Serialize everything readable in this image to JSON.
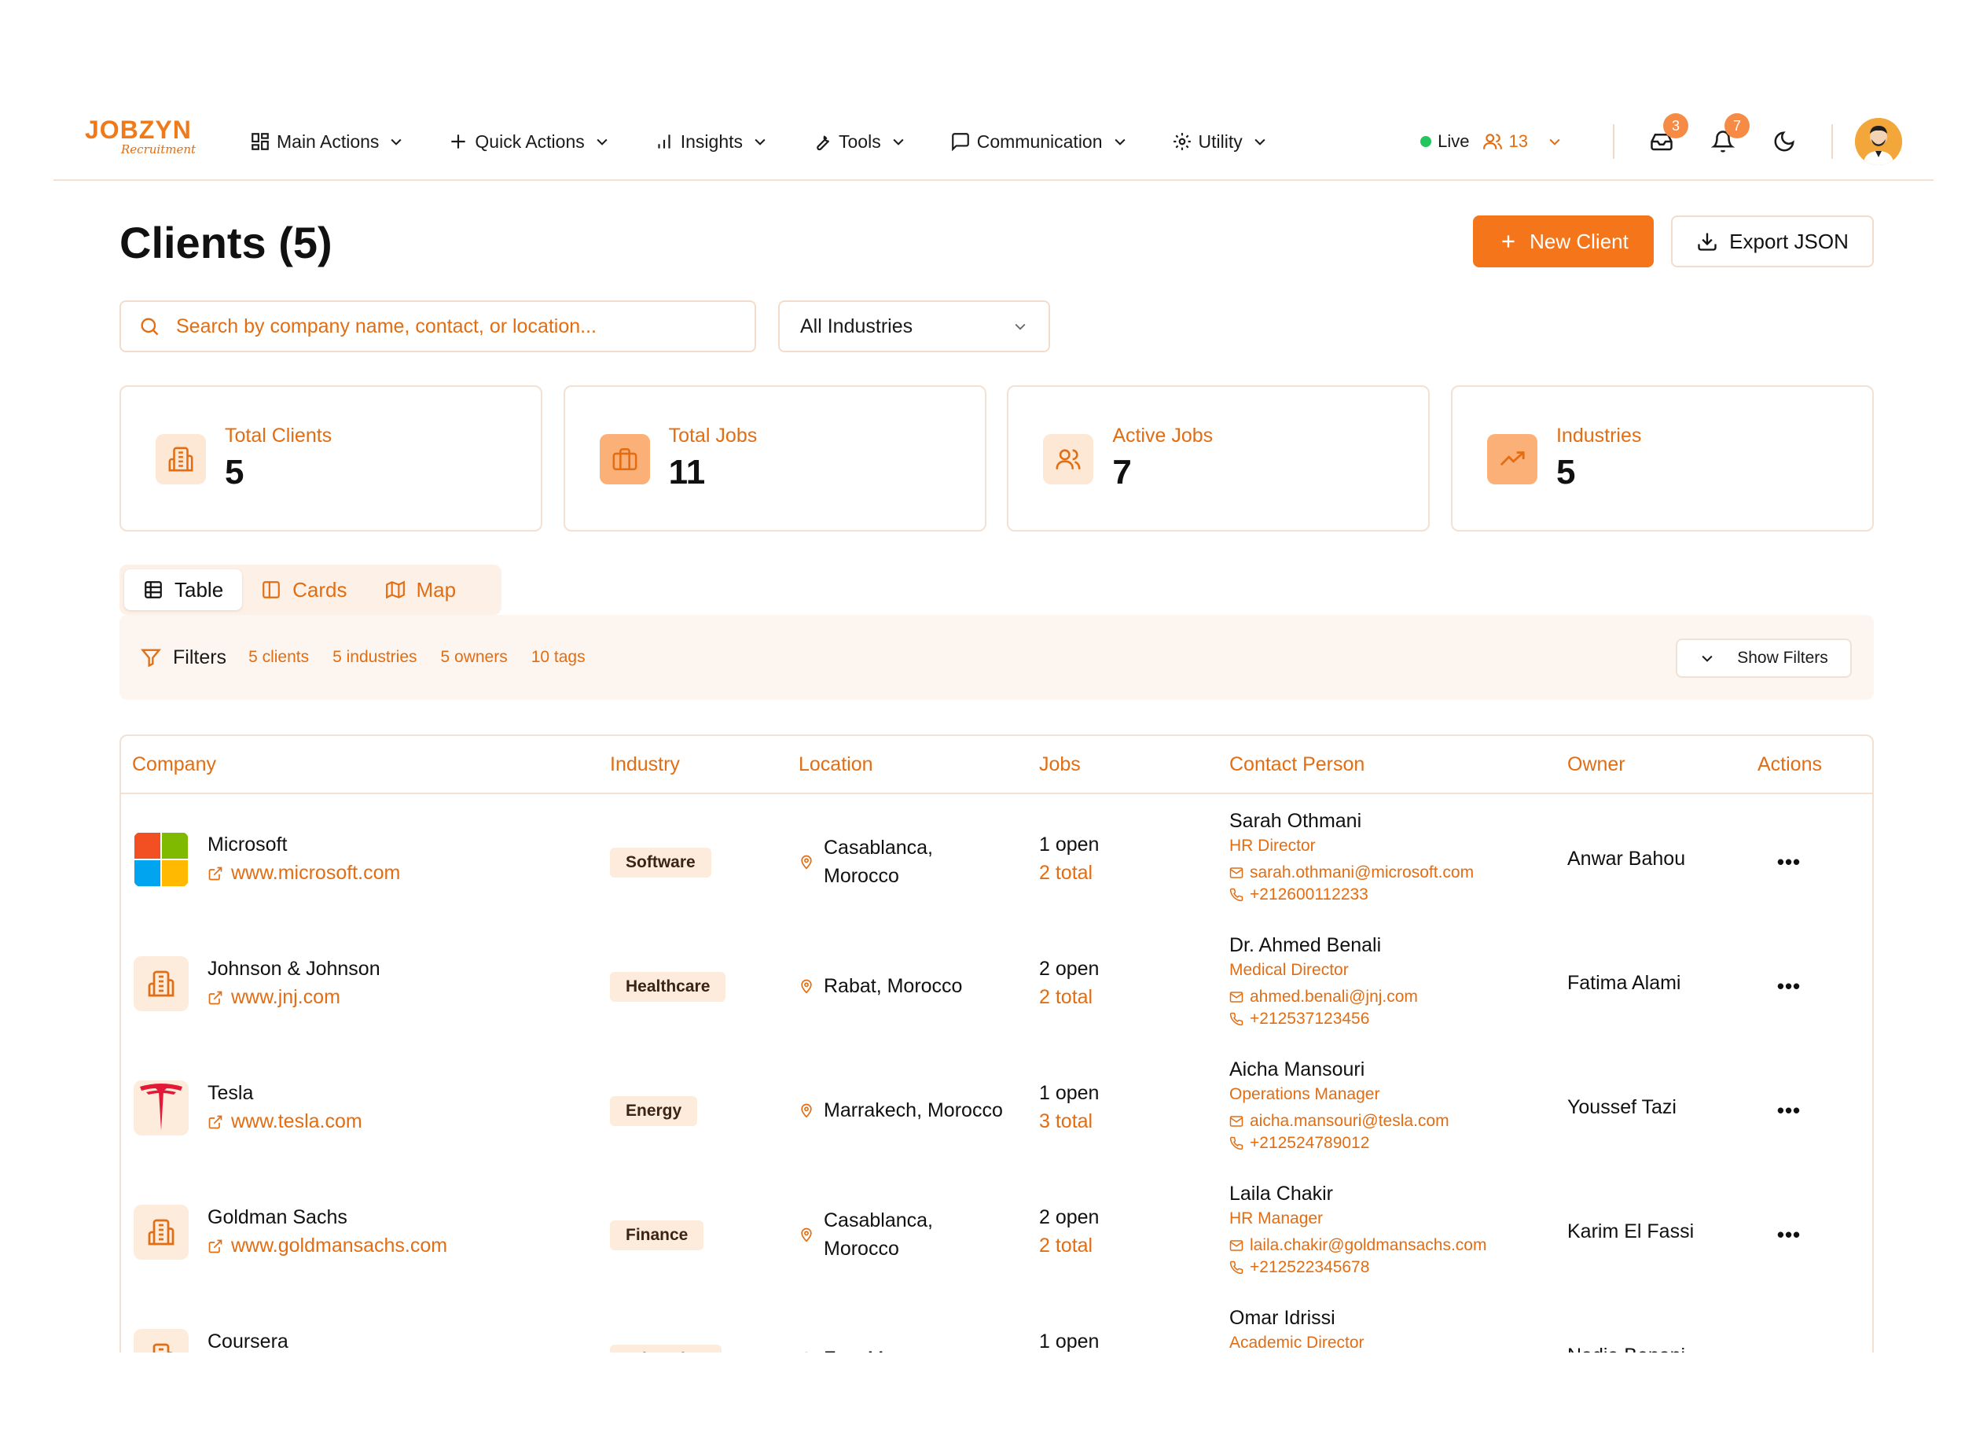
{
  "brand": {
    "name": "JOBZYN",
    "tagline": "Recruitment"
  },
  "nav": {
    "items": [
      {
        "label": "Main Actions",
        "icon": "grid-icon"
      },
      {
        "label": "Quick Actions",
        "icon": "plus-icon"
      },
      {
        "label": "Insights",
        "icon": "bar-chart-icon"
      },
      {
        "label": "Tools",
        "icon": "wrench-icon"
      },
      {
        "label": "Communication",
        "icon": "message-square-icon"
      },
      {
        "label": "Utility",
        "icon": "settings-icon"
      }
    ],
    "live_label": "Live",
    "online_users": "13",
    "inbox_badge": "3",
    "notifications_badge": "7"
  },
  "page": {
    "title": "Clients (5)",
    "new_client_label": "New Client",
    "export_label": "Export JSON",
    "search_placeholder": "Search by company name, contact, or location...",
    "industry_select": "All Industries"
  },
  "stats": [
    {
      "label": "Total Clients",
      "value": "5",
      "icon": "building-icon"
    },
    {
      "label": "Total Jobs",
      "value": "11",
      "icon": "briefcase-icon"
    },
    {
      "label": "Active Jobs",
      "value": "7",
      "icon": "users-icon"
    },
    {
      "label": "Industries",
      "value": "5",
      "icon": "trending-up-icon"
    }
  ],
  "views": {
    "table": "Table",
    "cards": "Cards",
    "map": "Map",
    "active": "Table"
  },
  "filters": {
    "title": "Filters",
    "chips": [
      "5 clients",
      "5 industries",
      "5 owners",
      "10 tags"
    ],
    "toggle_label": "Show Filters"
  },
  "table": {
    "headers": [
      "Company",
      "Industry",
      "Location",
      "Jobs",
      "Contact Person",
      "Owner",
      "Actions"
    ],
    "rows": [
      {
        "company": "Microsoft",
        "website": "www.microsoft.com",
        "logo": "microsoft-logo",
        "industry": "Software",
        "location_line1": "Casablanca,",
        "location_line2": "Morocco",
        "jobs_open": "1 open",
        "jobs_total": "2 total",
        "contact_name": "Sarah Othmani",
        "contact_role": "HR Director",
        "contact_email": "sarah.othmani@microsoft.com",
        "contact_phone": "+212600112233",
        "owner": "Anwar Bahou"
      },
      {
        "company": "Johnson & Johnson",
        "website": "www.jnj.com",
        "logo": "building-icon",
        "industry": "Healthcare",
        "location_line1": "Rabat, Morocco",
        "location_line2": "",
        "jobs_open": "2 open",
        "jobs_total": "2 total",
        "contact_name": "Dr. Ahmed Benali",
        "contact_role": "Medical Director",
        "contact_email": "ahmed.benali@jnj.com",
        "contact_phone": "+212537123456",
        "owner": "Fatima Alami"
      },
      {
        "company": "Tesla",
        "website": "www.tesla.com",
        "logo": "tesla-logo",
        "industry": "Energy",
        "location_line1": "Marrakech, Morocco",
        "location_line2": "",
        "jobs_open": "1 open",
        "jobs_total": "3 total",
        "contact_name": "Aicha Mansouri",
        "contact_role": "Operations Manager",
        "contact_email": "aicha.mansouri@tesla.com",
        "contact_phone": "+212524789012",
        "owner": "Youssef Tazi"
      },
      {
        "company": "Goldman Sachs",
        "website": "www.goldmansachs.com",
        "logo": "building-icon",
        "industry": "Finance",
        "location_line1": "Casablanca,",
        "location_line2": "Morocco",
        "jobs_open": "2 open",
        "jobs_total": "2 total",
        "contact_name": "Laila Chakir",
        "contact_role": "HR Manager",
        "contact_email": "laila.chakir@goldmansachs.com",
        "contact_phone": "+212522345678",
        "owner": "Karim El Fassi"
      },
      {
        "company": "Coursera",
        "website": "",
        "logo": "building-icon",
        "industry": "Education",
        "location_line1": "Fes, Morocco",
        "location_line2": "",
        "jobs_open": "1 open",
        "jobs_total": "",
        "contact_name": "Omar Idrissi",
        "contact_role": "Academic Director",
        "contact_email": "",
        "contact_phone": "",
        "owner": "Nadia Benani"
      }
    ]
  },
  "colors": {
    "accent": "#f5761a",
    "accent_text": "#e26d12",
    "border": "#f3e1d3",
    "tint": "#fdebdc"
  }
}
